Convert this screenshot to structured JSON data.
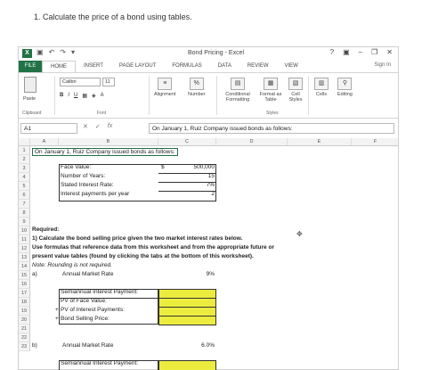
{
  "question": "1. Calculate the price of a bond using tables.",
  "window": {
    "title": "Bond Pricing - Excel",
    "controls": [
      "?",
      "▣",
      "–",
      "❐",
      "✕"
    ],
    "sign_in": "Sign In"
  },
  "tabs": [
    "FILE",
    "HOME",
    "INSERT",
    "PAGE LAYOUT",
    "FORMULAS",
    "DATA",
    "REVIEW",
    "VIEW"
  ],
  "ribbon": {
    "paste": "Paste",
    "clipboard": "Clipboard",
    "font_name": "Calibri",
    "font_size": "11",
    "font_group": "Font",
    "bold": "B",
    "italic": "I",
    "underline": "U",
    "alignment": "Alignment",
    "number": "Number",
    "percent": "%",
    "conditional": "Conditional Formatting",
    "format_table": "Format as Table",
    "cell_styles": "Cell Styles",
    "styles_group": "Styles",
    "cells": "Cells",
    "editing": "Editing"
  },
  "formula_bar": {
    "name_box": "A1",
    "content": "On January 1, Ruiz Company issued bonds as follows:"
  },
  "columns": [
    "A",
    "B",
    "C",
    "D",
    "E",
    "F"
  ],
  "rows": [
    "1",
    "2",
    "3",
    "4",
    "5",
    "6",
    "7",
    "8",
    "9",
    "10",
    "11",
    "12",
    "13",
    "14",
    "15",
    "16",
    "17",
    "18",
    "19",
    "20",
    "21",
    "22",
    "23"
  ],
  "sheet": {
    "a1": "On January 1, Ruiz Company issued bonds as follows:",
    "face_value_label": "Face Value:",
    "face_value_symbol": "$",
    "face_value": "500,000",
    "years_label": "Number of Years:",
    "years": "15",
    "rate_label": "Stated Interest Rate:",
    "rate": "7%",
    "payments_label": "Interest payments per year",
    "payments": "2",
    "required": "Required:",
    "line10": "1) Calculate the bond selling price given the two market interest rates below.",
    "line11": "Use formulas that reference data from this worksheet and from the appropriate future or",
    "line12": "present value tables (found by clicking the tabs at the bottom of this worksheet).",
    "line13": "Note: Rounding is not required.",
    "a_label": "a)",
    "a_market": "Annual Market Rate",
    "a_rate": "9%",
    "semi_payment": "Semiannual Interest Payment:",
    "pv_face": "PV of Face Value:",
    "pv_interest": "PV of Interest Payments:",
    "selling_price": "Bond Selling Price:",
    "plus": "+",
    "b_label": "b)",
    "b_market": "Annual Market Rate",
    "b_rate": "6.0%",
    "semi_payment_b": "Semiannual Interest Payment:"
  }
}
